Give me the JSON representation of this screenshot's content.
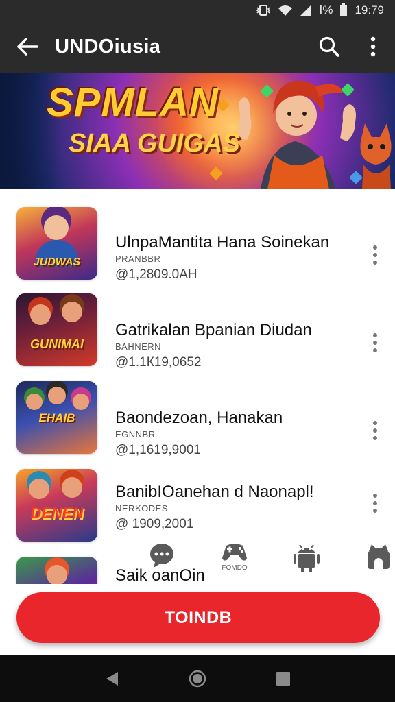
{
  "status_bar": {
    "indicators": "Ⅰ%",
    "time": "19:79",
    "icons": [
      "vibrate-icon",
      "wifi-icon",
      "signal-icon",
      "battery-icon"
    ]
  },
  "app_bar": {
    "title": "UNDOiusia",
    "icons": [
      "back-arrow-icon",
      "search-icon",
      "more-vert-icon"
    ]
  },
  "banner": {
    "line1": "SPMLAN",
    "line2": "SIAA GUIGAS"
  },
  "items": [
    {
      "title": "UlnpaMantita Hana Soinekan",
      "subtitle": "PRANBBR",
      "count": "@1,2809.0АН",
      "thumb_text": "JUDWAS",
      "thumb_colors": [
        "#f7b23a",
        "#c0365a",
        "#3b2a8a"
      ]
    },
    {
      "title": "Gatrikalan Bpanian Diudan",
      "subtitle": "BAHNERN",
      "count": "@1.1К19,0652",
      "thumb_text": "GUNIMAI",
      "thumb_colors": [
        "#d23a2a",
        "#6b1f3a",
        "#2a1630"
      ]
    },
    {
      "title": "Baondezoan, Hanakan",
      "subtitle": "EGNNBR",
      "count": "@1,1619,9001",
      "thumb_text": "EHAIB",
      "thumb_colors": [
        "#e9763a",
        "#3b4fb0",
        "#1d2b5a"
      ]
    },
    {
      "title": "BanibIOanehan d Naonapl!",
      "subtitle": "NERKODES",
      "count": "@ 1909,2001",
      "thumb_text": "DENEN",
      "thumb_colors": [
        "#f5a52a",
        "#3a8a3a",
        "#2a3a8a"
      ]
    },
    {
      "title": "Saik oanOin",
      "subtitle": "",
      "count": "",
      "thumb_text": "",
      "thumb_colors": [
        "#3b9a4a",
        "#e5562a",
        "#5b2a9a"
      ]
    }
  ],
  "floating_icons": [
    {
      "name": "chat-icon",
      "label": ""
    },
    {
      "name": "game-controller-icon",
      "label": "FOMDO"
    },
    {
      "name": "android-icon",
      "label": ""
    },
    {
      "name": "lock-icon",
      "label": ""
    }
  ],
  "cta": {
    "label": "TOINDB"
  },
  "nav": {
    "icons": [
      "nav-back-icon",
      "nav-home-icon",
      "nav-recents-icon"
    ]
  },
  "colors": {
    "app_bar_bg": "#2b2b2b",
    "accent": "#e8262b",
    "nav_bg": "#0d0d0d"
  }
}
